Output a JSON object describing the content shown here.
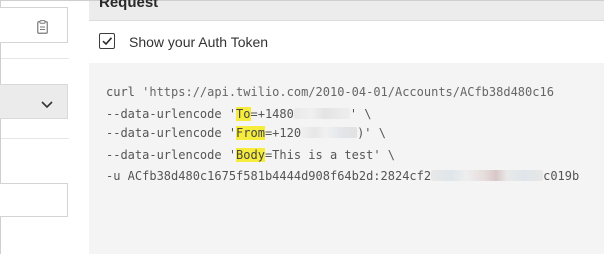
{
  "request": {
    "title": "Request",
    "show_token": {
      "checked": true,
      "label": "Show your Auth Token"
    }
  },
  "code": {
    "line1": {
      "prefix": "curl ",
      "text": "'https://api.twilio.com/2010-04-01/Accounts/ACfb38d480c16"
    },
    "line2": {
      "prefix": "--data-urlencode '",
      "key": "To",
      "rest": "=+1480",
      "close": "' \\"
    },
    "line3": {
      "prefix": "--data-urlencode '",
      "key": "From",
      "rest": "=+120",
      "close": ")' \\"
    },
    "line4": {
      "prefix": "--data-urlencode '",
      "key": "Body",
      "rest": "=This is a test' \\"
    },
    "line5": {
      "prefix": "-u ACfb38d480c1675f581b4444d908f64b2d:2824cf2",
      "suffix": "c019b"
    }
  },
  "colors": {
    "highlight": "#f6ec3e",
    "panel_bg": "#f4f4f4",
    "header_bg": "#ececec"
  },
  "icons": {
    "clipboard": "clipboard-icon",
    "chevron": "chevron-down-icon",
    "checkmark": "checkmark-icon"
  }
}
